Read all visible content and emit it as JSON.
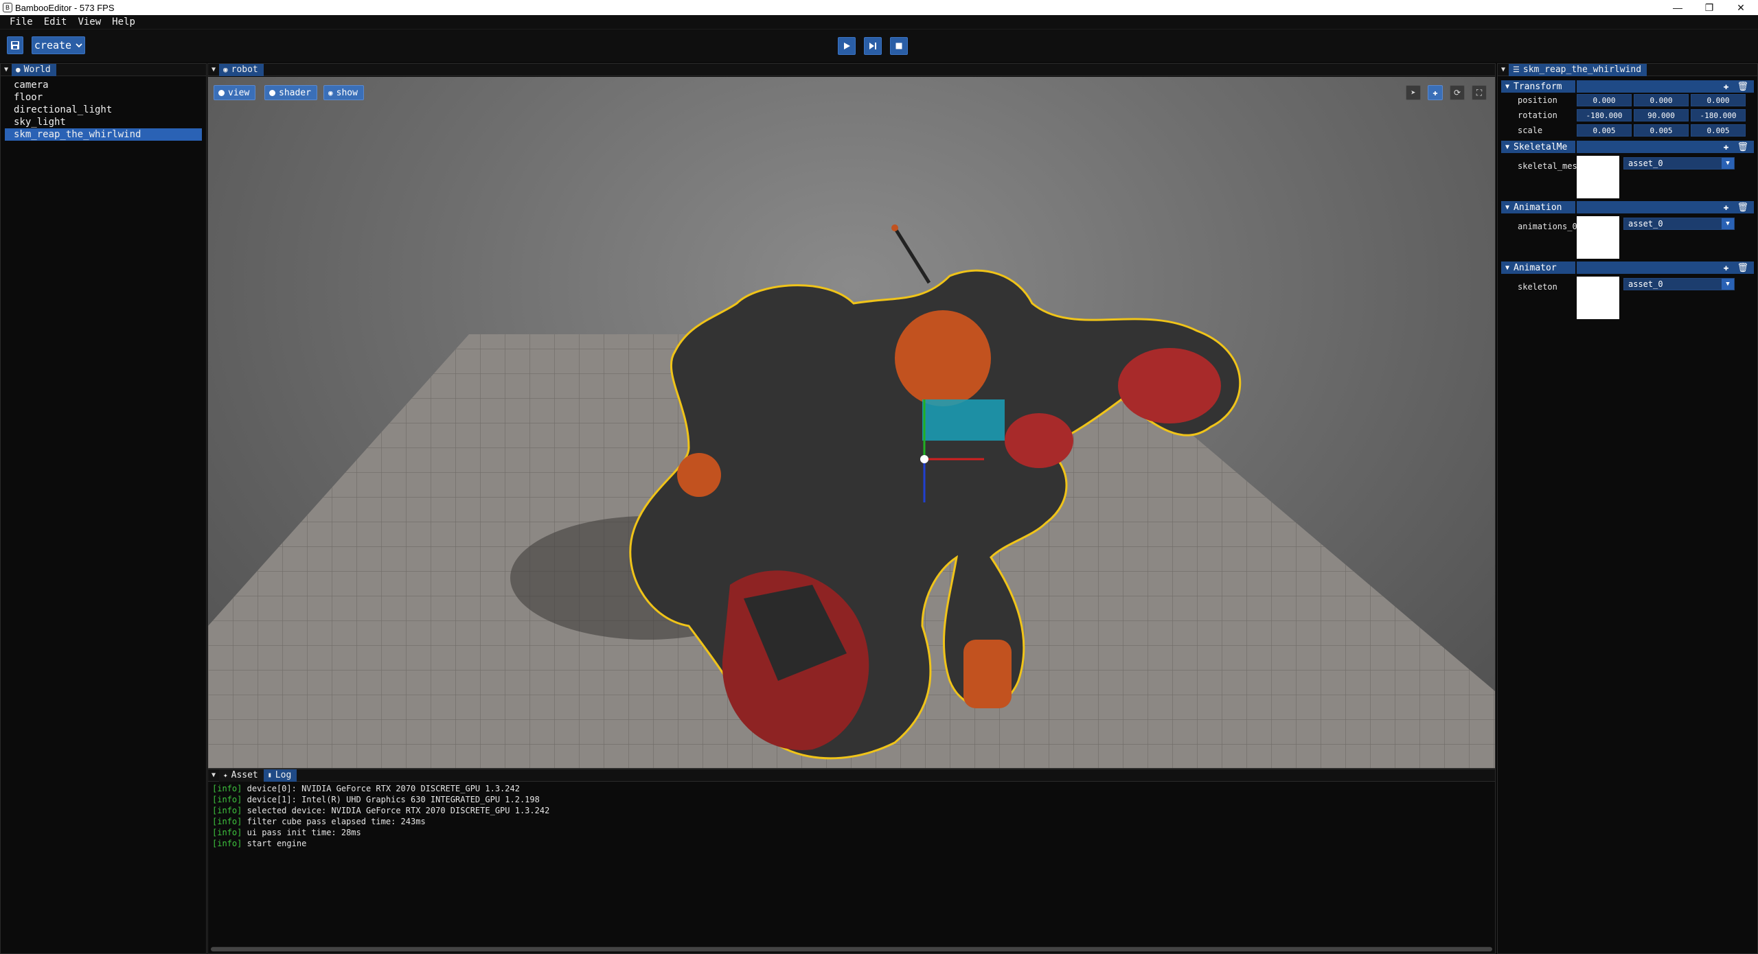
{
  "window": {
    "title": "BambooEditor - 573 FPS"
  },
  "menubar": {
    "items": [
      "File",
      "Edit",
      "View",
      "Help"
    ]
  },
  "toolbar": {
    "create_label": "create"
  },
  "world_panel": {
    "title": "World",
    "items": [
      "camera",
      "floor",
      "directional_light",
      "sky_light",
      "skm_reap_the_whirlwind"
    ],
    "selected_index": 4
  },
  "viewport": {
    "tab_title": "robot",
    "buttons": {
      "view": "view",
      "shader": "shader",
      "show": "show"
    }
  },
  "bottom_panel": {
    "tabs": [
      "Asset",
      "Log"
    ],
    "log": [
      {
        "tag": "[info]",
        "msg": "device[0]: NVIDIA GeForce RTX 2070 DISCRETE_GPU 1.3.242"
      },
      {
        "tag": "[info]",
        "msg": "device[1]: Intel(R) UHD Graphics 630 INTEGRATED_GPU 1.2.198"
      },
      {
        "tag": "[info]",
        "msg": "selected device: NVIDIA GeForce RTX 2070 DISCRETE_GPU 1.3.242"
      },
      {
        "tag": "[info]",
        "msg": "filter cube pass elapsed time: 243ms"
      },
      {
        "tag": "[info]",
        "msg": "ui pass init time: 28ms"
      },
      {
        "tag": "[info]",
        "msg": "start engine"
      }
    ]
  },
  "inspector": {
    "title": "skm_reap_the_whirlwind",
    "transform": {
      "label": "Transform",
      "position_label": "position",
      "rotation_label": "rotation",
      "scale_label": "scale",
      "position": [
        "0.000",
        "0.000",
        "0.000"
      ],
      "rotation": [
        "-180.000",
        "90.000",
        "-180.000"
      ],
      "scale": [
        "0.005",
        "0.005",
        "0.005"
      ]
    },
    "skeletal_mesh": {
      "label": "SkeletalMe",
      "field": "skeletal_mesh",
      "value": "asset_0"
    },
    "animation": {
      "label": "Animation",
      "field": "animations_0",
      "value": "asset_0"
    },
    "animator": {
      "label": "Animator",
      "field": "skeleton",
      "value": "asset_0"
    }
  },
  "colors": {
    "accent": "#1f4a86",
    "selection": "#2a62b5",
    "log_tag": "#3ec43e",
    "outline": "#f0c419"
  }
}
